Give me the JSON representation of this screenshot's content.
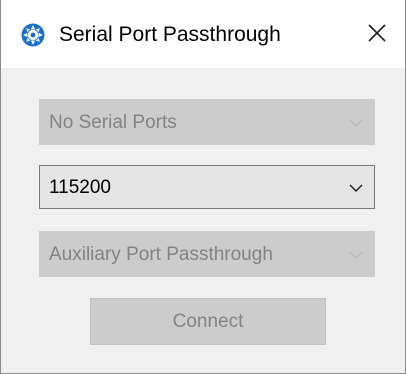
{
  "window": {
    "title": "Serial Port Passthrough",
    "close_label": "Close"
  },
  "icons": {
    "app": "app-logo-icon",
    "close": "close-icon",
    "chevron": "chevron-down-icon"
  },
  "serial_port": {
    "value": "No Serial Ports",
    "enabled": false
  },
  "baud_rate": {
    "value": "115200",
    "enabled": true
  },
  "passthrough_mode": {
    "value": "Auxiliary Port Passthrough",
    "enabled": false
  },
  "connect_button": {
    "label": "Connect",
    "enabled": false
  },
  "colors": {
    "app_icon_blue": "#1a6fc9",
    "disabled_text": "#838383",
    "disabled_fill": "#cccccc",
    "enabled_border": "#7a7a7a"
  }
}
